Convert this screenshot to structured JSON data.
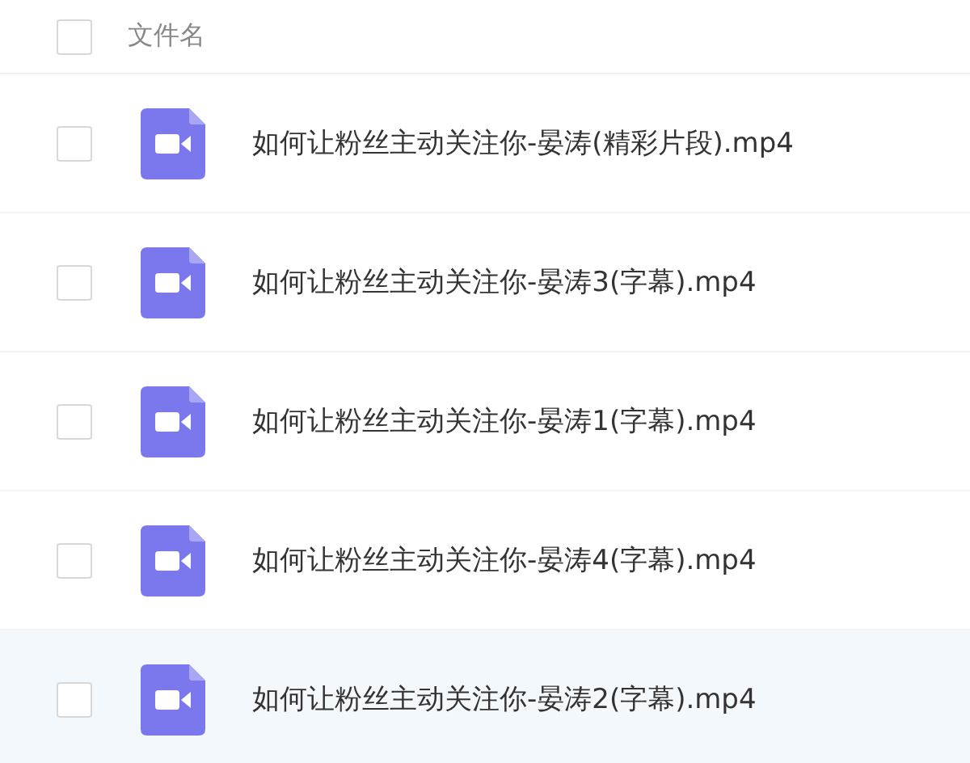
{
  "header": {
    "label": "文件名",
    "checked": false
  },
  "files": [
    {
      "name": "如何让粉丝主动关注你-晏涛(精彩片段).mp4",
      "checked": false,
      "highlighted": false
    },
    {
      "name": "如何让粉丝主动关注你-晏涛3(字幕).mp4",
      "checked": false,
      "highlighted": false
    },
    {
      "name": "如何让粉丝主动关注你-晏涛1(字幕).mp4",
      "checked": false,
      "highlighted": false
    },
    {
      "name": "如何让粉丝主动关注你-晏涛4(字幕).mp4",
      "checked": false,
      "highlighted": false
    },
    {
      "name": "如何让粉丝主动关注你-晏涛2(字幕).mp4",
      "checked": false,
      "highlighted": true
    }
  ]
}
